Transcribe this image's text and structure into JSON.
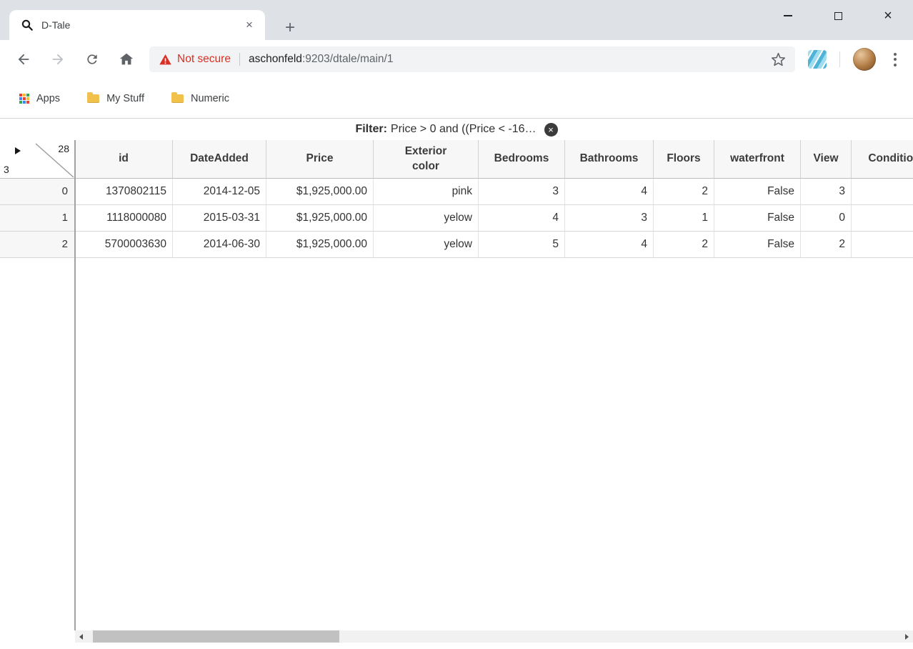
{
  "browser": {
    "tab_title": "D-Tale",
    "address": {
      "security_label": "Not secure",
      "url_host": "aschonfeld",
      "url_rest": ":9203/dtale/main/1"
    },
    "bookmarks": [
      {
        "label": "Apps"
      },
      {
        "label": "My Stuff"
      },
      {
        "label": "Numeric"
      }
    ]
  },
  "icons": {
    "close_glyph": "×",
    "plus_glyph": "+"
  },
  "app": {
    "filter_bar": {
      "label": "Filter:",
      "query": "Price > 0 and ((Price < -16…"
    },
    "grid": {
      "corner": {
        "column_count": "28",
        "row_count": "3"
      },
      "columns": [
        "id",
        "DateAdded",
        "Price",
        "Exterior color",
        "Bedrooms",
        "Bathrooms",
        "Floors",
        "waterfront",
        "View",
        "Condition"
      ],
      "rows": [
        {
          "index": "0",
          "cells": [
            "1370802115",
            "2014-12-05",
            "$1,925,000.00",
            "pink",
            "3",
            "4",
            "2",
            "False",
            "3",
            ""
          ]
        },
        {
          "index": "1",
          "cells": [
            "1118000080",
            "2015-03-31",
            "$1,925,000.00",
            "yelow",
            "4",
            "3",
            "1",
            "False",
            "0",
            ""
          ]
        },
        {
          "index": "2",
          "cells": [
            "5700003630",
            "2014-06-30",
            "$1,925,000.00",
            "yelow",
            "5",
            "4",
            "2",
            "False",
            "2",
            ""
          ]
        }
      ]
    }
  },
  "colors": {
    "not_secure_red": "#d93025",
    "folder_yellow": "#f2c14b",
    "tabstrip_bg": "#dee1e6",
    "grid_header_bg": "#f7f7f7",
    "scrollbar_thumb": "#c1c1c1"
  }
}
